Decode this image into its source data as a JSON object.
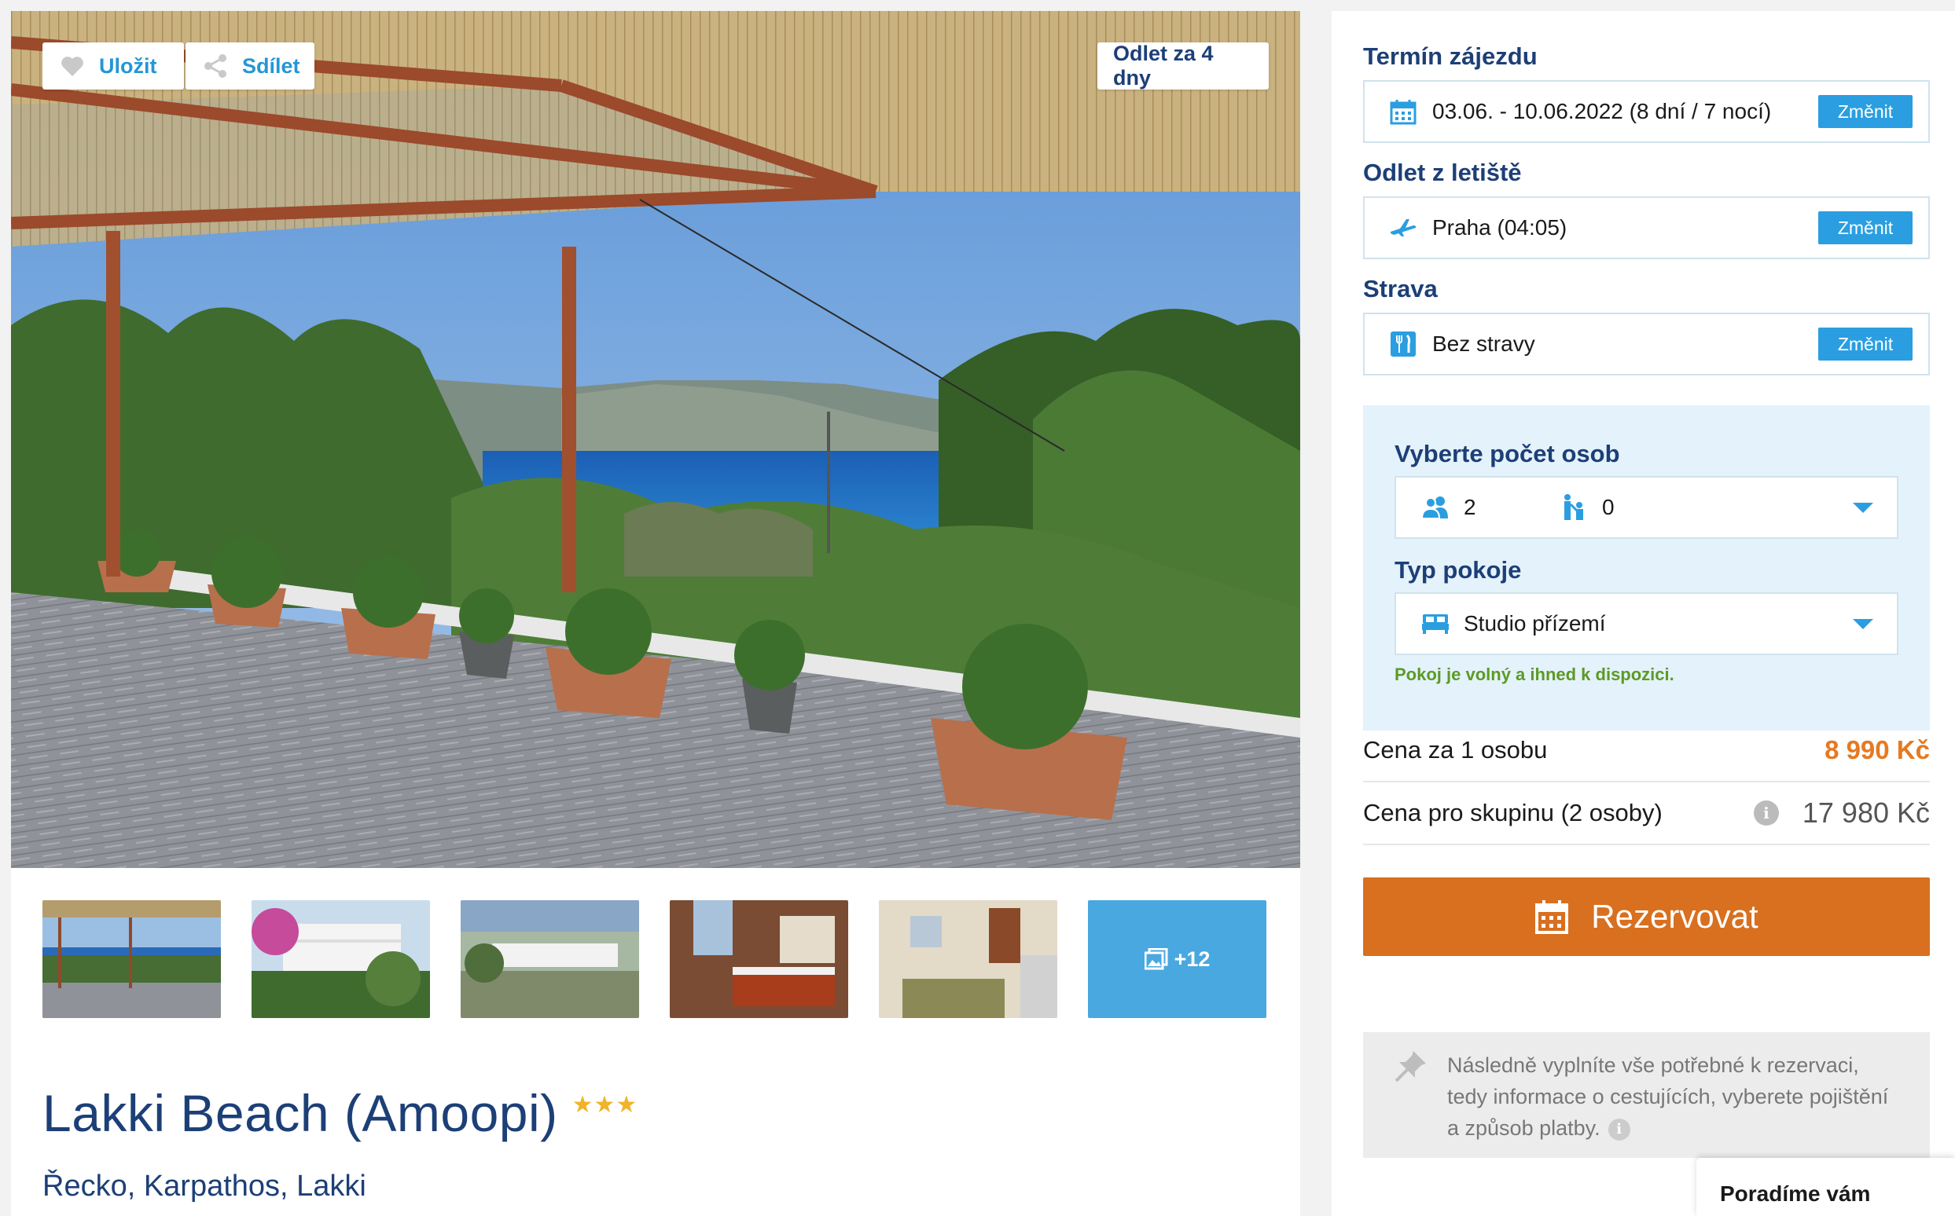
{
  "gallery": {
    "save_label": "Uložit",
    "share_label": "Sdílet",
    "departure_badge": "Odlet za 4 dny",
    "more_photos": "+12"
  },
  "hotel": {
    "name": "Lakki Beach (Amoopi)",
    "stars": "★★★",
    "location": "Řecko, Karpathos, Lakki"
  },
  "booking": {
    "term_label": "Termín zájezdu",
    "term_value": "03.06. - 10.06.2022 (8 dní / 7 nocí)",
    "airport_label": "Odlet z letiště",
    "airport_value": "Praha (04:05)",
    "board_label": "Strava",
    "board_value": "Bez stravy",
    "change_label": "Změnit",
    "persons_label": "Vyberte počet osob",
    "adults": "2",
    "children": "0",
    "room_label": "Typ pokoje",
    "room_value": "Studio přízemí",
    "availability": "Pokoj je volný a ihned k dispozici.",
    "price_person_label": "Cena za 1 osobu",
    "price_person_value": "8 990 Kč",
    "price_group_label": "Cena pro skupinu (2 osoby)",
    "price_group_value": "17 980 Kč",
    "reserve_label": "Rezervovat",
    "note": "Následně vyplníte vše potřebné k rezervaci, tedy informace o cestujících, vyberete pojištění a způsob platby."
  },
  "chat": {
    "label": "Poradíme vám"
  },
  "colors": {
    "brand_blue": "#1d3f77",
    "accent_blue": "#2a9ee0",
    "reserve_orange": "#d8701f",
    "price_orange": "#e57a22",
    "available_green": "#5c9a25"
  }
}
